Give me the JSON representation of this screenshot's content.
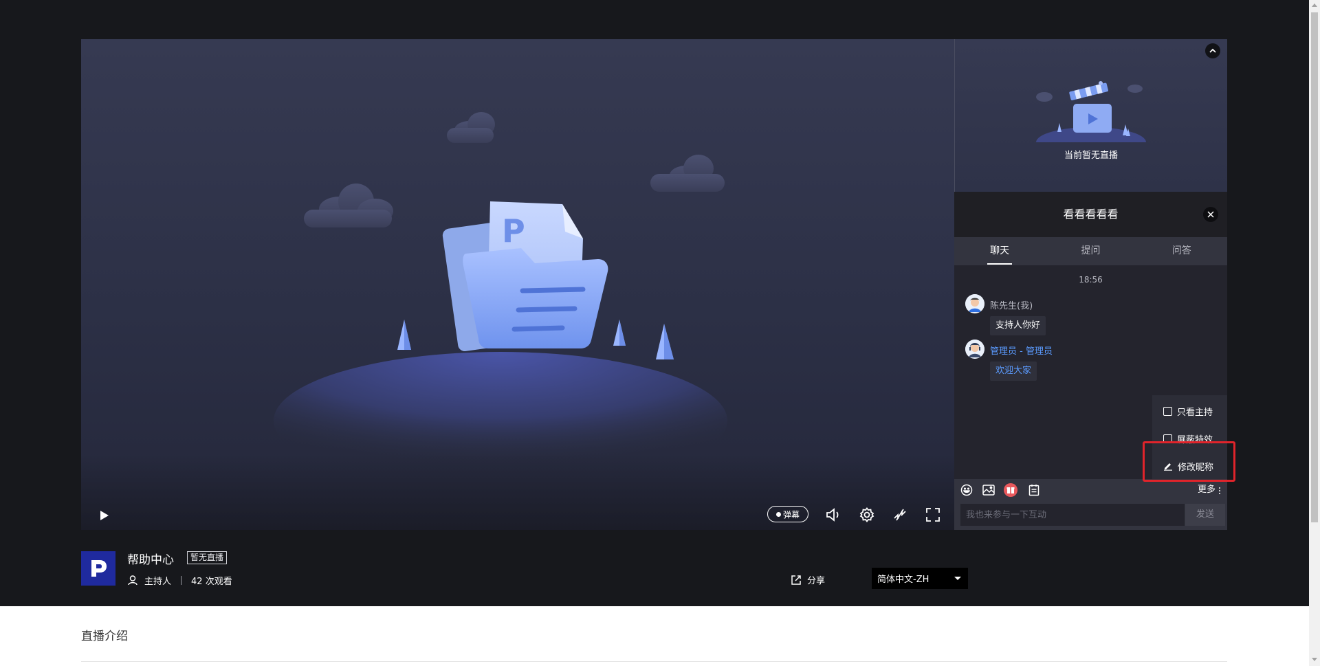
{
  "player": {
    "danmu_label": "弹幕",
    "icons": [
      "play-icon",
      "volume-icon",
      "settings-icon",
      "line-switch-icon",
      "fullscreen-icon"
    ]
  },
  "side_panel": {
    "mini_status": "当前暂无直播",
    "chat_title": "看看看看看",
    "tabs": [
      {
        "label": "聊天",
        "active": true
      },
      {
        "label": "提问",
        "active": false
      },
      {
        "label": "问答",
        "active": false
      }
    ],
    "chat": {
      "time": "18:56",
      "messages": [
        {
          "name": "陈先生(我)",
          "text": "支持人你好",
          "name_color": "#b8b9c2",
          "text_color": "#ffffff"
        },
        {
          "name": "管理员 - 管理员",
          "text": "欢迎大家",
          "name_color": "#5b9bff",
          "text_color": "#5b9bff"
        }
      ]
    },
    "more_menu": {
      "items": [
        {
          "label": "只看主持",
          "type": "checkbox",
          "checked": false
        },
        {
          "label": "屏蔽特效",
          "type": "checkbox",
          "checked": false
        },
        {
          "label": "修改昵称",
          "type": "action"
        }
      ]
    },
    "toolbar": {
      "icons": [
        "emoji-icon",
        "image-icon",
        "gift-icon",
        "notes-icon"
      ],
      "more_label": "更多"
    },
    "input": {
      "placeholder": "我也来参与一下互动",
      "value": "",
      "send_label": "发送"
    }
  },
  "info": {
    "logo_letter": "P",
    "title": "帮助中心",
    "status_badge": "暂无直播",
    "host_label": "主持人",
    "views": "42 次观看",
    "share_label": "分享",
    "language": "简体中文-ZH"
  },
  "intro": {
    "title": "直播介绍"
  },
  "colors": {
    "page_dark": "#17181c",
    "player_bg": "#363a52",
    "accent_blue": "#5b9bff",
    "logo_bg": "#1f2a9e",
    "gift_red": "#e8585c",
    "highlight_red": "#e0242b"
  }
}
